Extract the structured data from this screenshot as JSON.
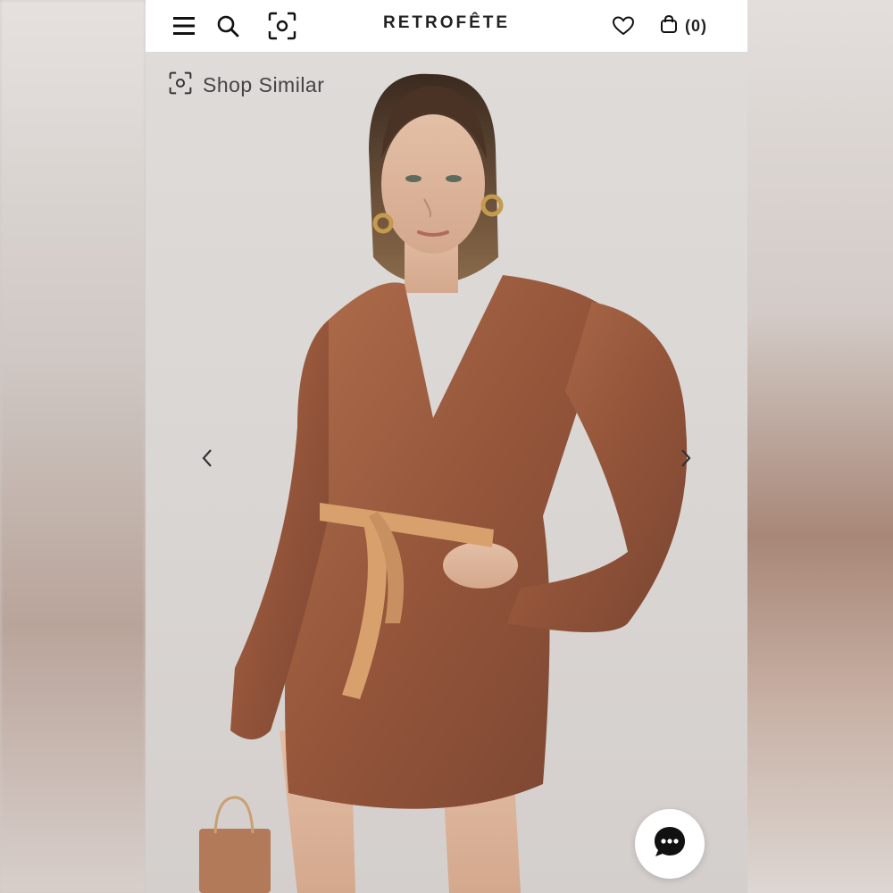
{
  "header": {
    "brand": "RETROFÊTE",
    "cart_count": "(0)",
    "icons": [
      "menu-icon",
      "search-icon",
      "camera-scan-icon",
      "heart-icon",
      "bag-icon"
    ]
  },
  "product": {
    "shop_similar_label": "Shop Similar",
    "image_description_colors": {
      "dress": "#9a5a3e",
      "belt": "#d8a06c",
      "background": "#dcd8d6"
    }
  },
  "colors": {
    "header_bg": "#ffffff",
    "text": "#222222"
  }
}
